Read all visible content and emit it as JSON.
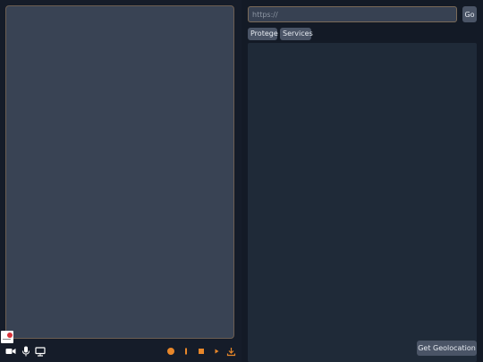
{
  "browser": {
    "url_placeholder": "https://",
    "url_value": "",
    "go_label": "Go"
  },
  "tabs": [
    {
      "label": "Protege"
    },
    {
      "label": "Services"
    }
  ],
  "actions": {
    "geolocation_label": "Get Geolocation"
  },
  "controls": {
    "left": [
      "camera-icon",
      "microphone-icon",
      "screen-share-icon"
    ],
    "right": [
      "record-icon",
      "pause-icon",
      "stop-icon",
      "play-icon",
      "download-icon"
    ]
  },
  "colors": {
    "accent": "#e8872a",
    "button_bg": "#4a5466",
    "panel_bg": "#1f2a38",
    "preview_bg": "#394354"
  }
}
